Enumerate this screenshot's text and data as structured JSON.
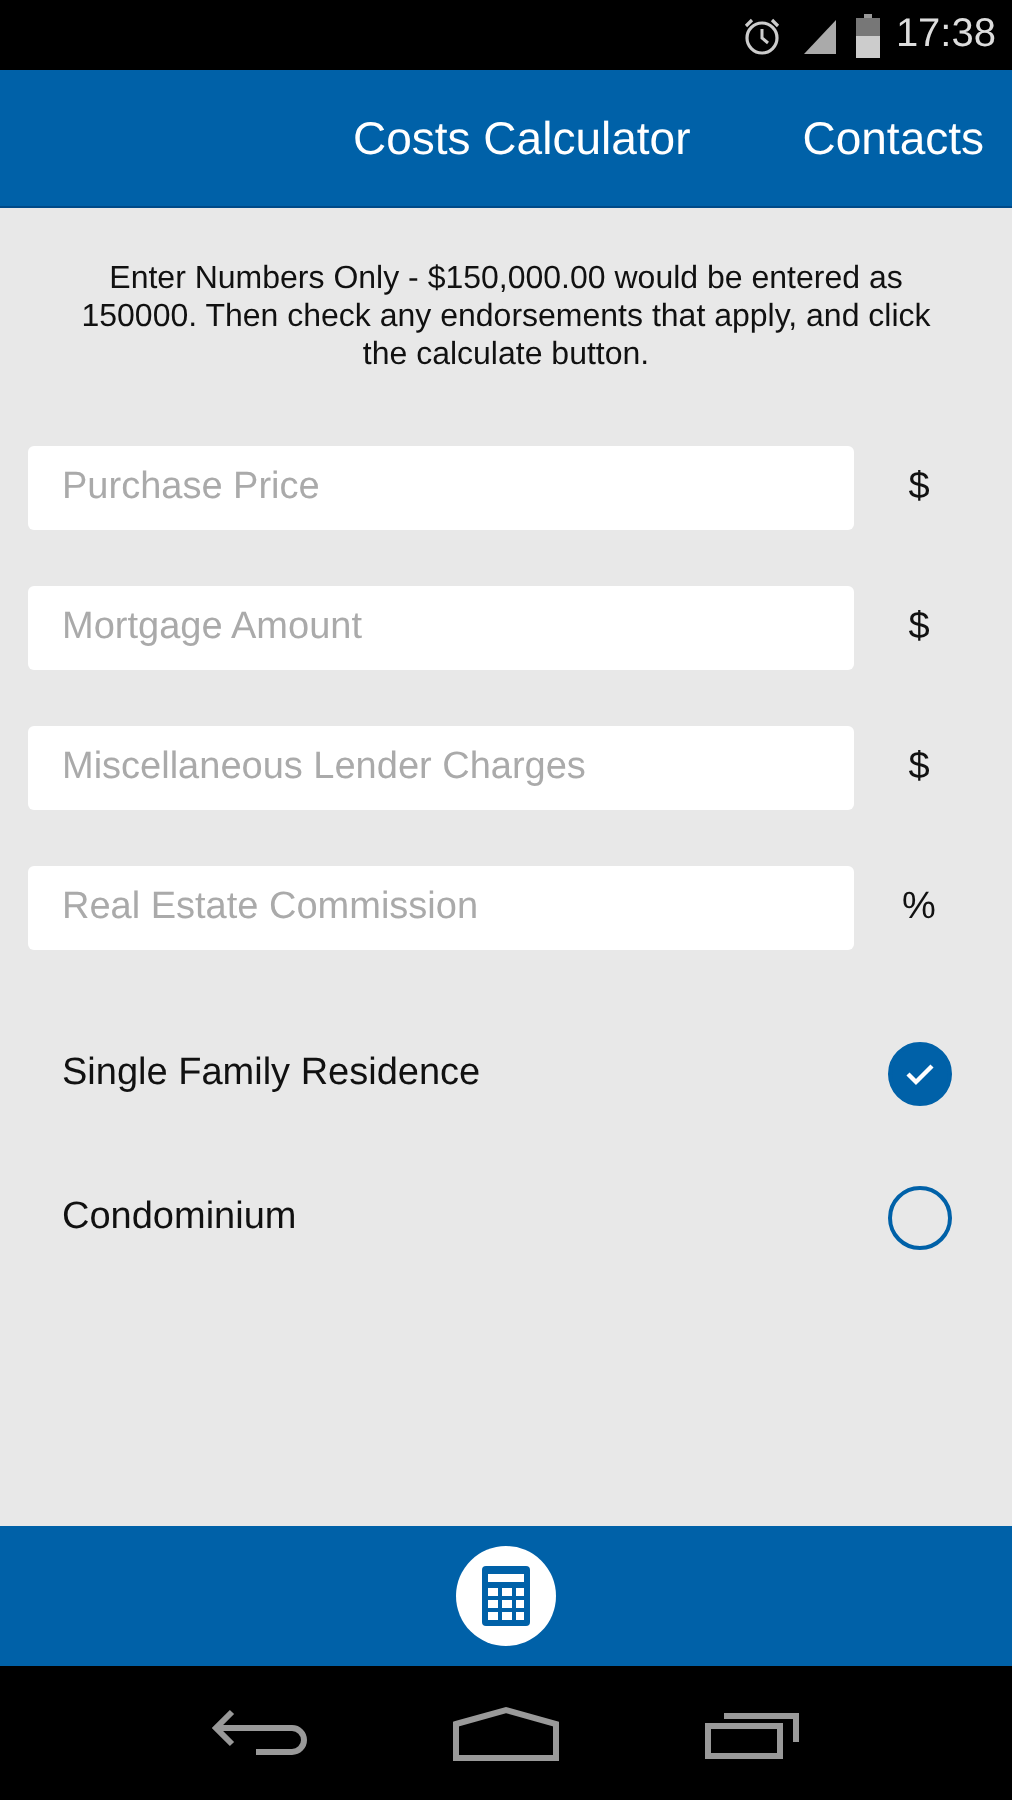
{
  "status_bar": {
    "time": "17:38"
  },
  "app_bar": {
    "actions": [
      "Costs Calculator",
      "Contacts"
    ]
  },
  "instructions": "Enter Numbers Only - $150,000.00 would be entered as 150000. Then check any endorsements that apply, and click the calculate button.",
  "fields": [
    {
      "placeholder": "Purchase Price",
      "unit": "$"
    },
    {
      "placeholder": "Mortgage Amount",
      "unit": "$"
    },
    {
      "placeholder": "Miscellaneous Lender Charges",
      "unit": "$"
    },
    {
      "placeholder": "Real Estate Commission",
      "unit": "%"
    }
  ],
  "endorsements": [
    {
      "label": "Single Family Residence",
      "checked": true
    },
    {
      "label": "Condominium",
      "checked": false
    }
  ]
}
